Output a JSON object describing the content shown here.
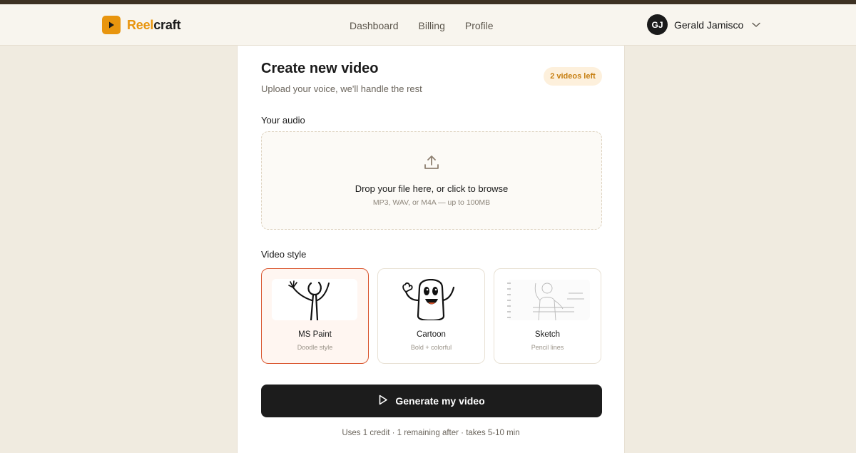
{
  "app": {
    "brand_accent": "Reel",
    "brand_rest": "craft",
    "brand_color": "#e8950e"
  },
  "nav": [
    {
      "label": "Dashboard"
    },
    {
      "label": "Billing"
    },
    {
      "label": "Profile"
    }
  ],
  "user": {
    "initials": "GJ",
    "name": "Gerald Jamisco"
  },
  "page": {
    "title": "Create new video",
    "subtitle": "Upload your voice, we'll handle the rest",
    "badge": "2 videos left"
  },
  "audio": {
    "label": "Your audio",
    "drop_title": "Drop your file here, or click to browse",
    "drop_hint": "MP3, WAV, or M4A — up to 100MB",
    "icon": "upload-icon"
  },
  "video_style": {
    "label": "Video style",
    "selected": "MS Paint",
    "options": [
      {
        "name": "MS Paint",
        "desc": "Doodle style"
      },
      {
        "name": "Cartoon",
        "desc": "Bold + colorful"
      },
      {
        "name": "Sketch",
        "desc": "Pencil lines"
      }
    ]
  },
  "generate": {
    "label": "Generate my video",
    "icon": "play-icon"
  },
  "footnote": "Uses 1 credit · 1 remaining after · takes 5-10 min",
  "colors": {
    "selected_border": "#d9542c",
    "badge_bg": "#fdf0dc",
    "badge_text": "#c67e10",
    "button_bg": "#1c1c1c"
  }
}
